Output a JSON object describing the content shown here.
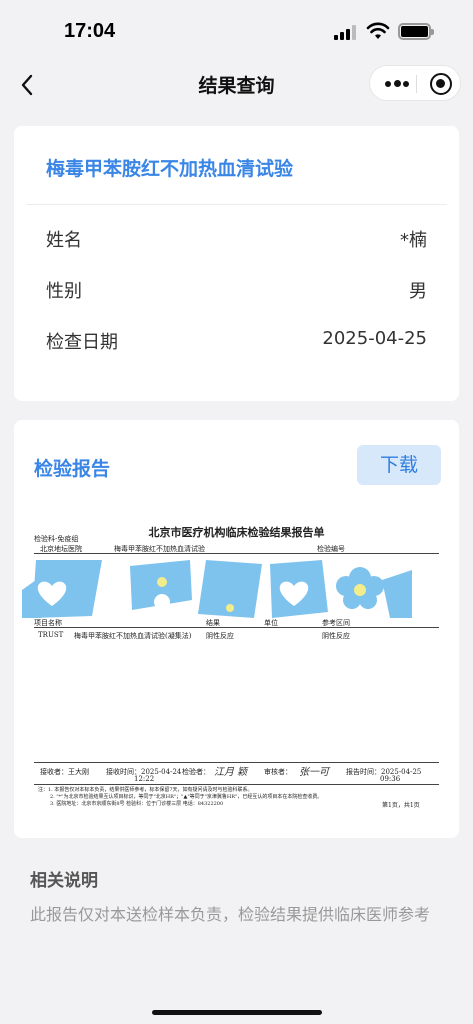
{
  "status": {
    "time": "17:04"
  },
  "nav": {
    "title": "结果查询"
  },
  "info": {
    "test_name": "梅毒甲苯胺红不加热血清试验",
    "rows": [
      {
        "label": "姓名",
        "value": "*楠"
      },
      {
        "label": "性别",
        "value": "男"
      },
      {
        "label": "检查日期",
        "value": "2025-04-25"
      }
    ]
  },
  "report": {
    "header": "检验报告",
    "download_label": "下载",
    "doc": {
      "title": "北京市医疗机构临床检验结果报告单",
      "dept": "检验科-免疫组",
      "hospital": "北京地坛医院",
      "item_title": "梅毒甲苯胺红不加热血清试验",
      "sample_no_label": "检验编号",
      "col_item": "项目名称",
      "col_result": "结果",
      "col_unit": "单位",
      "col_range": "参考区间",
      "row_code": "TRUST",
      "row_name": "梅毒甲苯胺红不加热血清试验(凝集法)",
      "row_result": "阴性反应",
      "row_range": "阴性反应",
      "receiver": "接收者：王大刚",
      "received_time": "接收时间：2025-04-24",
      "received_clock": "12:22",
      "inspector": "检验者：",
      "reviewer": "审核者：",
      "report_time": "报告时间：2025-04-25",
      "report_clock": "09:36",
      "note1": "注：1. 本报告仅对本标本负责，结果供医师参考，标本保留7天，如有疑问请及时与检验科联系。",
      "note2": "2. \"*\"为北京市检验结果互认项目标识，等同于\"北京HR\"；\"▲\"等同于\"京津冀鲁HR\"，已经互认的项目本在本院检查收费。",
      "note3": "3. 医院地址：北京市京顺东街8号  检验科：位于门诊楼三层  电话：84322200",
      "page": "第1页，共1页"
    }
  },
  "notes": {
    "title": "相关说明",
    "body": "此报告仅对本送检样本负责，检验结果提供临床医师参考"
  },
  "colors": {
    "accent": "#3a86e6",
    "button_bg": "#d8e8fb",
    "watermark": "#7ec3ee"
  }
}
